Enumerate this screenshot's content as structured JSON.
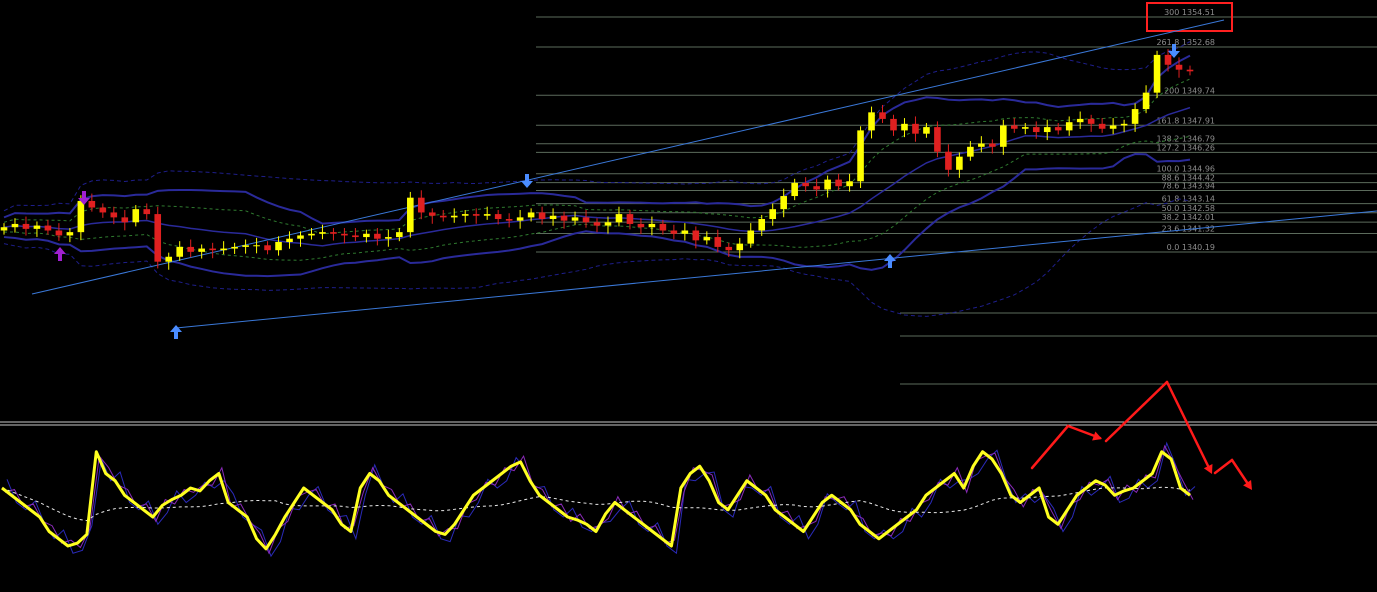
{
  "colors": {
    "background": "#000000",
    "price_line": "#c8c8c8",
    "fib_line": "#5c6b5c",
    "fib_label": "#8c8c8c",
    "bollinger": "#2a2a9a",
    "bollinger_dashed": "#1e1e8a",
    "green_dashed": "#2f7a2f",
    "trendline": "#3a78d8",
    "candle_up": "#ffff00",
    "candle_down": "#e02020",
    "osc_main": "#ffff20",
    "osc_purple": "#8a2ab8",
    "osc_blue": "#2a2ab8",
    "osc_signal": "#e8e8e8",
    "annotation": "#ff1a1a",
    "highlight_box": "#ff2020",
    "arrow_up": "#4a8cff",
    "arrow_down": "#4a8cff",
    "arrow_purple": "#a020d0"
  },
  "fib_levels": [
    {
      "label": "300 1354.51",
      "price": 1354.51,
      "highlighted": true
    },
    {
      "label": "261.8 1352.68",
      "price": 1352.68
    },
    {
      "label": "200 1349.74",
      "price": 1349.74
    },
    {
      "label": "161.8 1347.91",
      "price": 1347.91
    },
    {
      "label": "138.2 1346.79",
      "price": 1346.79
    },
    {
      "label": "127.2 1346.26",
      "price": 1346.26
    },
    {
      "label": "100.0 1344.96",
      "price": 1344.96
    },
    {
      "label": "88.6 1344.42",
      "price": 1344.42
    },
    {
      "label": "78.6 1343.94",
      "price": 1343.94
    },
    {
      "label": "61.8 1343.14",
      "price": 1343.14
    },
    {
      "label": "50.0 1342.58",
      "price": 1342.58
    },
    {
      "label": "38.2 1342.01",
      "price": 1342.01
    },
    {
      "label": "23.6 1341.32",
      "price": 1341.32
    },
    {
      "label": "0.0 1340.19",
      "price": 1340.19
    }
  ],
  "chart_data": {
    "type": "line",
    "title": "",
    "panels": [
      "price",
      "oscillator"
    ],
    "price_close": [
      1341.7,
      1341.9,
      1341.6,
      1341.8,
      1341.5,
      1341.2,
      1341.4,
      1343.3,
      1342.9,
      1342.6,
      1342.3,
      1342.0,
      1342.8,
      1342.5,
      1339.6,
      1339.9,
      1340.5,
      1340.2,
      1340.4,
      1340.3,
      1340.4,
      1340.5,
      1340.6,
      1340.6,
      1340.3,
      1340.8,
      1341.0,
      1341.2,
      1341.3,
      1341.4,
      1341.3,
      1341.2,
      1341.1,
      1341.3,
      1341.0,
      1341.1,
      1341.4,
      1343.5,
      1342.6,
      1342.4,
      1342.3,
      1342.4,
      1342.5,
      1342.4,
      1342.5,
      1342.2,
      1342.1,
      1342.3,
      1342.6,
      1342.2,
      1342.4,
      1342.1,
      1342.3,
      1342.0,
      1341.8,
      1342.0,
      1342.5,
      1341.9,
      1341.7,
      1341.9,
      1341.5,
      1341.3,
      1341.5,
      1340.9,
      1341.1,
      1340.5,
      1340.3,
      1340.7,
      1341.5,
      1342.2,
      1342.8,
      1343.6,
      1344.4,
      1344.2,
      1344.0,
      1344.6,
      1344.2,
      1344.5,
      1347.6,
      1348.7,
      1348.3,
      1347.6,
      1348.0,
      1347.4,
      1347.8,
      1346.3,
      1345.2,
      1346.0,
      1346.6,
      1346.8,
      1346.6,
      1347.9,
      1347.7,
      1347.8,
      1347.5,
      1347.8,
      1347.6,
      1348.1,
      1348.3,
      1348.0,
      1347.7,
      1347.9,
      1348.0,
      1348.9,
      1349.9,
      1352.2,
      1351.6,
      1351.3,
      1351.2
    ],
    "oscillator_main": [
      60,
      55,
      50,
      45,
      40,
      30,
      25,
      20,
      22,
      28,
      85,
      70,
      65,
      55,
      50,
      45,
      40,
      48,
      52,
      55,
      60,
      58,
      65,
      70,
      50,
      45,
      40,
      25,
      18,
      28,
      40,
      50,
      60,
      55,
      50,
      45,
      35,
      30,
      60,
      70,
      65,
      55,
      50,
      45,
      40,
      35,
      30,
      28,
      35,
      45,
      55,
      60,
      65,
      70,
      75,
      78,
      65,
      55,
      50,
      45,
      40,
      38,
      35,
      30,
      42,
      50,
      45,
      40,
      35,
      30,
      25,
      20,
      60,
      70,
      75,
      65,
      50,
      45,
      55,
      65,
      60,
      55,
      45,
      40,
      35,
      30,
      40,
      50,
      55,
      50,
      45,
      35,
      30,
      25,
      30,
      35,
      40,
      45,
      55,
      60,
      65,
      70,
      60,
      75,
      85,
      80,
      70,
      55,
      50,
      55,
      60,
      40,
      35,
      45,
      55,
      60,
      65,
      62,
      55,
      58,
      60,
      65,
      70,
      85,
      80,
      60,
      55
    ]
  }
}
